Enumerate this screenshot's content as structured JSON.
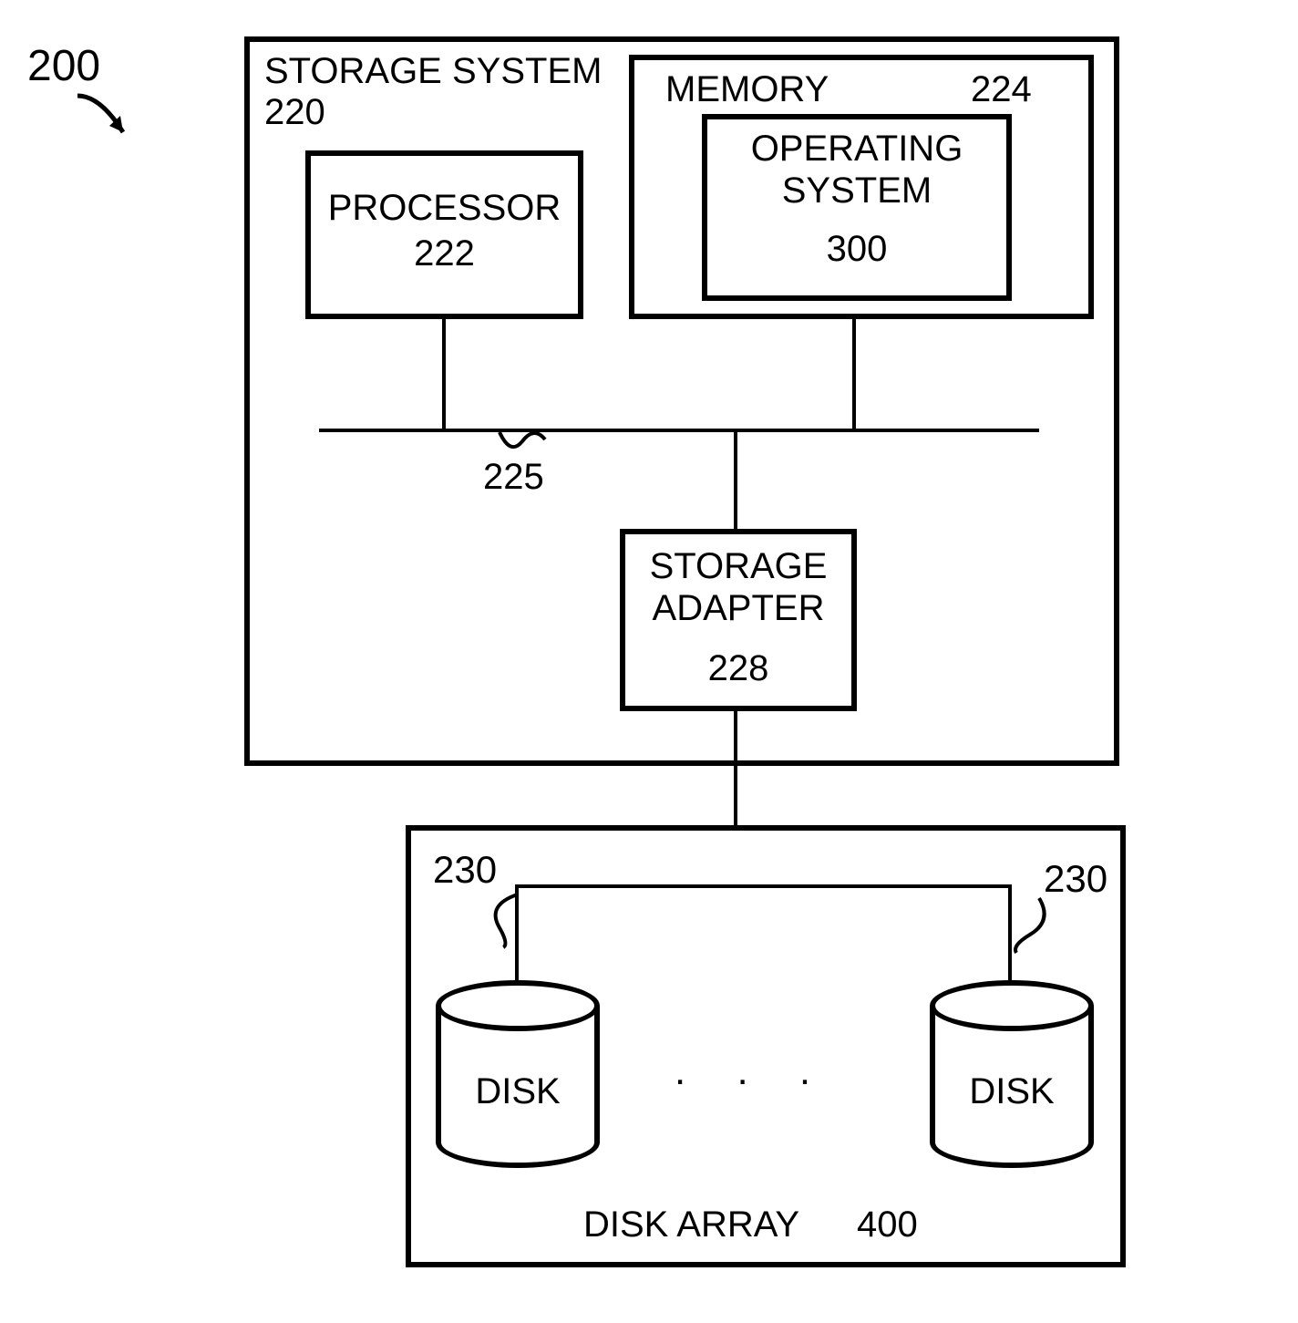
{
  "ref_200": "200",
  "storage_system": {
    "title": "STORAGE SYSTEM",
    "num": "220",
    "processor": {
      "label": "PROCESSOR",
      "num": "222"
    },
    "memory": {
      "label": "MEMORY",
      "num": "224",
      "os": {
        "label": "OPERATING\nSYSTEM",
        "num": "300"
      }
    },
    "bus_num": "225",
    "storage_adapter": {
      "label": "STORAGE\nADAPTER",
      "num": "228"
    }
  },
  "disk_array": {
    "title": "DISK ARRAY",
    "num": "400",
    "disk_label": "DISK",
    "disk_ref": "230"
  }
}
